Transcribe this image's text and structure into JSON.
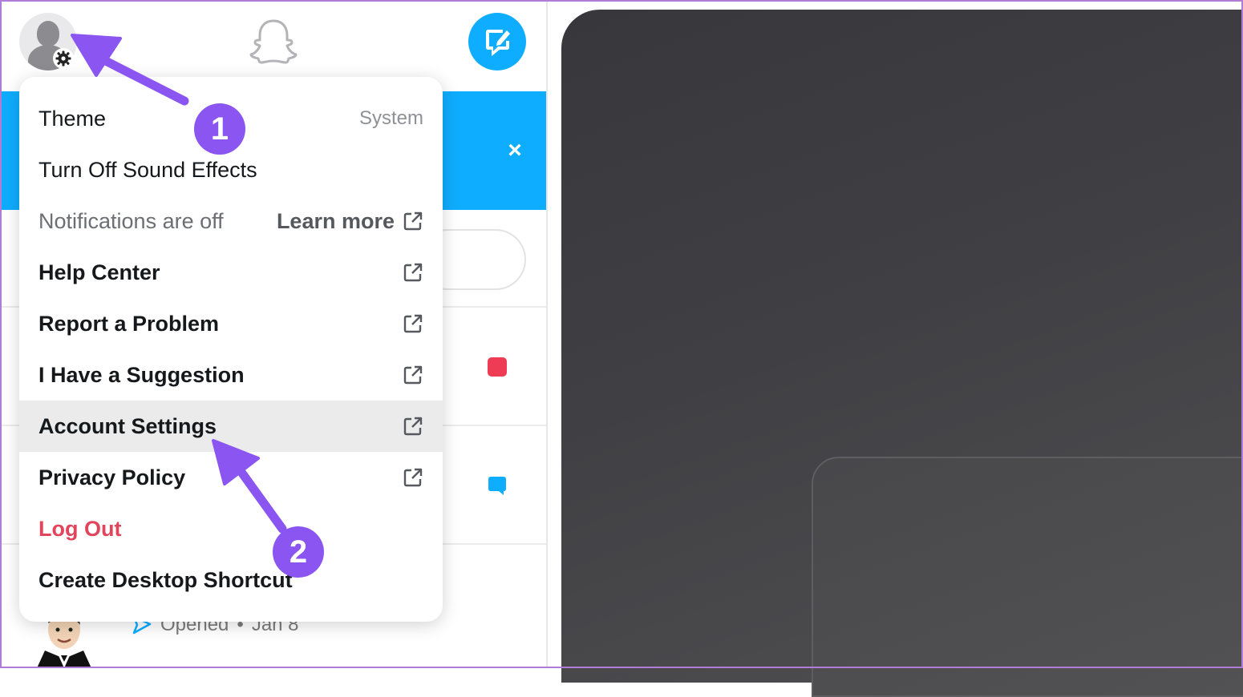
{
  "menu": {
    "items": [
      {
        "label": "Theme",
        "value": "System"
      },
      {
        "label": "Turn Off Sound Effects"
      },
      {
        "label": "Notifications are off",
        "link": "Learn more"
      },
      {
        "label": "Help Center"
      },
      {
        "label": "Report a Problem"
      },
      {
        "label": "I Have a Suggestion"
      },
      {
        "label": "Account Settings"
      },
      {
        "label": "Privacy Policy"
      },
      {
        "label": "Log Out"
      },
      {
        "label": "Create Desktop Shortcut"
      }
    ]
  },
  "banner": {
    "close_glyph": "×"
  },
  "chat": {
    "status": "Opened",
    "separator": "•",
    "date": "Jan 8"
  },
  "annotations": {
    "step1": "1",
    "step2": "2"
  },
  "colors": {
    "accent_blue": "#0fadff",
    "annotation_purple": "#8a55f0",
    "logout_red": "#e1455c",
    "unread_red": "#ef3c55"
  },
  "icons": {
    "avatar": "avatar-icon",
    "settings": "gear-icon",
    "snapchat": "ghost-icon",
    "compose": "compose-icon",
    "external_link": "external-link-icon",
    "close": "close-icon"
  }
}
